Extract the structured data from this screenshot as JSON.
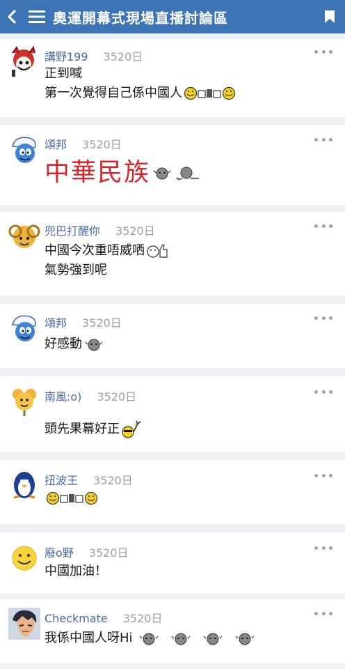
{
  "header": {
    "title": "奧運開幕式現場直播討論區",
    "back_icon": "chevron-left-icon",
    "menu_icon": "hamburger-menu-icon",
    "bookmark_icon": "bookmark-icon",
    "color": "#3d74b5"
  },
  "posts": [
    {
      "author": "講野199",
      "days": "3520日",
      "lines": [
        "正到喊",
        "第一次覺得自己係中國人"
      ]
    },
    {
      "author": "頌邦",
      "days": "3520日",
      "lines": [
        "中華民族"
      ]
    },
    {
      "author": "兜巴打醒你",
      "days": "3520日",
      "lines": [
        "中國今次重唔威哂",
        "氣勢強到呢"
      ]
    },
    {
      "author": "頌邦",
      "days": "3520日",
      "lines": [
        "好感動"
      ]
    },
    {
      "author": "南風:o)",
      "days": "3520日",
      "lines": [
        "頭先果幕好正"
      ]
    },
    {
      "author": "扭波王",
      "days": "3520日",
      "lines": [
        ""
      ]
    },
    {
      "author": "廢o野",
      "days": "3520日",
      "lines": [
        "中國加油！"
      ]
    },
    {
      "author": "Checkmate",
      "days": "3520日",
      "lines": [
        "我係中國人呀Hi"
      ]
    }
  ],
  "colors": {
    "author": "#4a69a6",
    "days": "#9aa0a8",
    "big_text": "#d4262b"
  }
}
